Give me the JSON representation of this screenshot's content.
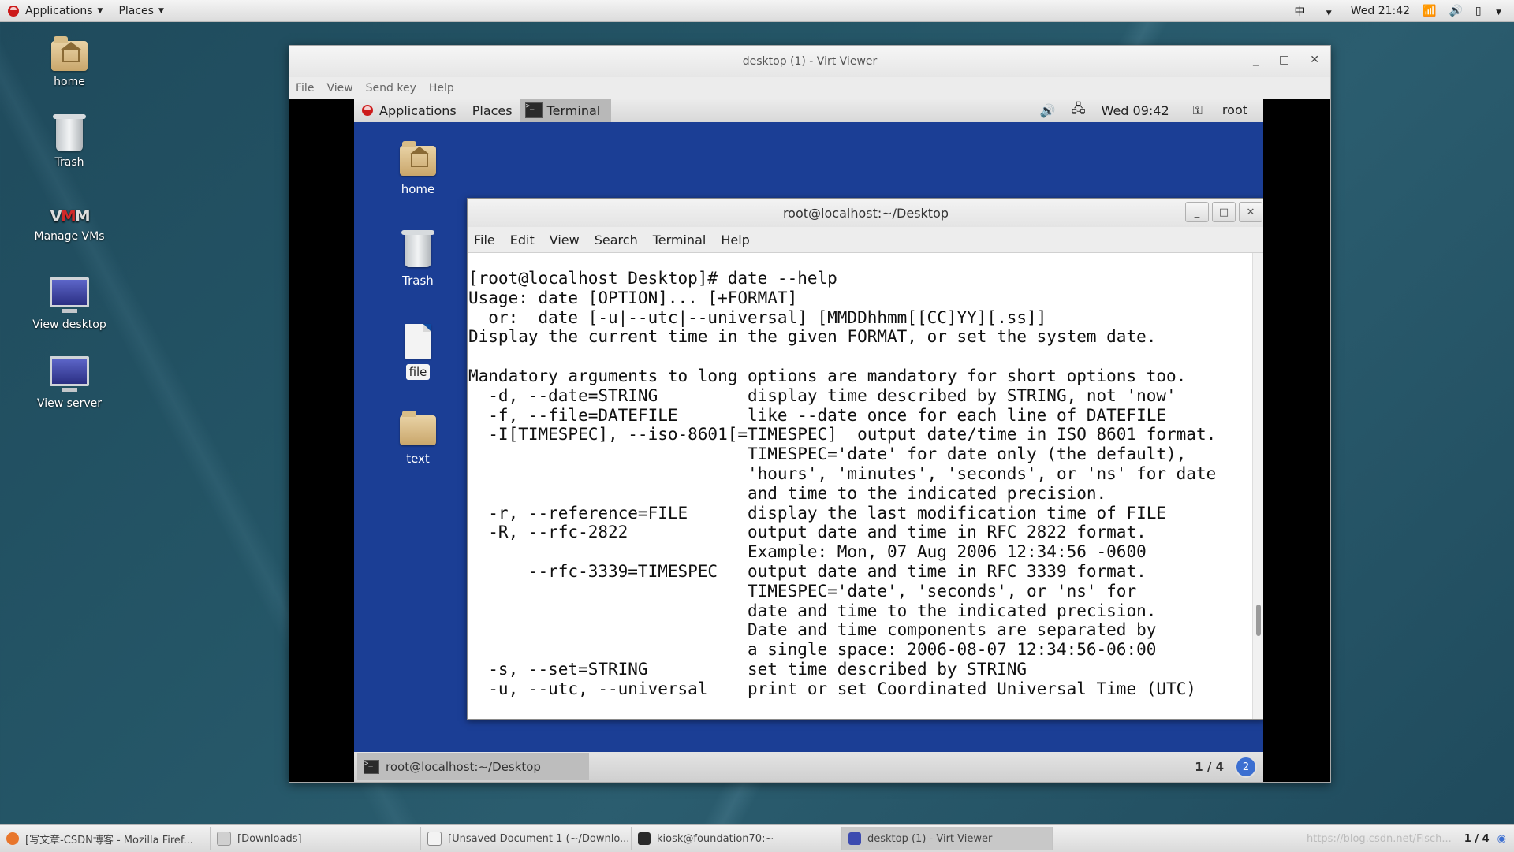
{
  "host_top": {
    "applications": "Applications",
    "places": "Places",
    "input_method": "中",
    "clock": "Wed 21:42"
  },
  "host_desktop": {
    "icons": [
      "home",
      "Trash",
      "Manage VMs",
      "View desktop",
      "View server"
    ]
  },
  "viewer": {
    "title": "desktop (1) - Virt Viewer",
    "menu": [
      "File",
      "View",
      "Send key",
      "Help"
    ]
  },
  "guest_top": {
    "applications": "Applications",
    "places": "Places",
    "terminal": "Terminal",
    "clock": "Wed 09:42",
    "user": "root"
  },
  "guest_desktop": {
    "icons": [
      "home",
      "Trash",
      "file",
      "text"
    ]
  },
  "terminal": {
    "title": "root@localhost:~/Desktop",
    "menu": [
      "File",
      "Edit",
      "View",
      "Search",
      "Terminal",
      "Help"
    ],
    "lines": [
      "[root@localhost Desktop]# date --help",
      "Usage: date [OPTION]... [+FORMAT]",
      "  or:  date [-u|--utc|--universal] [MMDDhhmm[[CC]YY][.ss]]",
      "Display the current time in the given FORMAT, or set the system date.",
      "",
      "Mandatory arguments to long options are mandatory for short options too.",
      "  -d, --date=STRING         display time described by STRING, not 'now'",
      "  -f, --file=DATEFILE       like --date once for each line of DATEFILE",
      "  -I[TIMESPEC], --iso-8601[=TIMESPEC]  output date/time in ISO 8601 format.",
      "                            TIMESPEC='date' for date only (the default),",
      "                            'hours', 'minutes', 'seconds', or 'ns' for date",
      "                            and time to the indicated precision.",
      "  -r, --reference=FILE      display the last modification time of FILE",
      "  -R, --rfc-2822            output date and time in RFC 2822 format.",
      "                            Example: Mon, 07 Aug 2006 12:34:56 -0600",
      "      --rfc-3339=TIMESPEC   output date and time in RFC 3339 format.",
      "                            TIMESPEC='date', 'seconds', or 'ns' for",
      "                            date and time to the indicated precision.",
      "                            Date and time components are separated by",
      "                            a single space: 2006-08-07 12:34:56-06:00",
      "  -s, --set=STRING          set time described by STRING",
      "  -u, --utc, --universal    print or set Coordinated Universal Time (UTC)"
    ]
  },
  "guest_bottom": {
    "task": "root@localhost:~/Desktop",
    "workspace": "1 / 4",
    "help": "2"
  },
  "taskbar": {
    "items": [
      "[写文章-CSDN博客 - Mozilla Firef...",
      "[Downloads]",
      "[Unsaved Document 1 (~/Downlo...",
      "kiosk@foundation70:~",
      "desktop (1) - Virt Viewer"
    ],
    "watermark": "https://blog.csdn.net/Fisch...",
    "workspace": "1 / 4"
  }
}
